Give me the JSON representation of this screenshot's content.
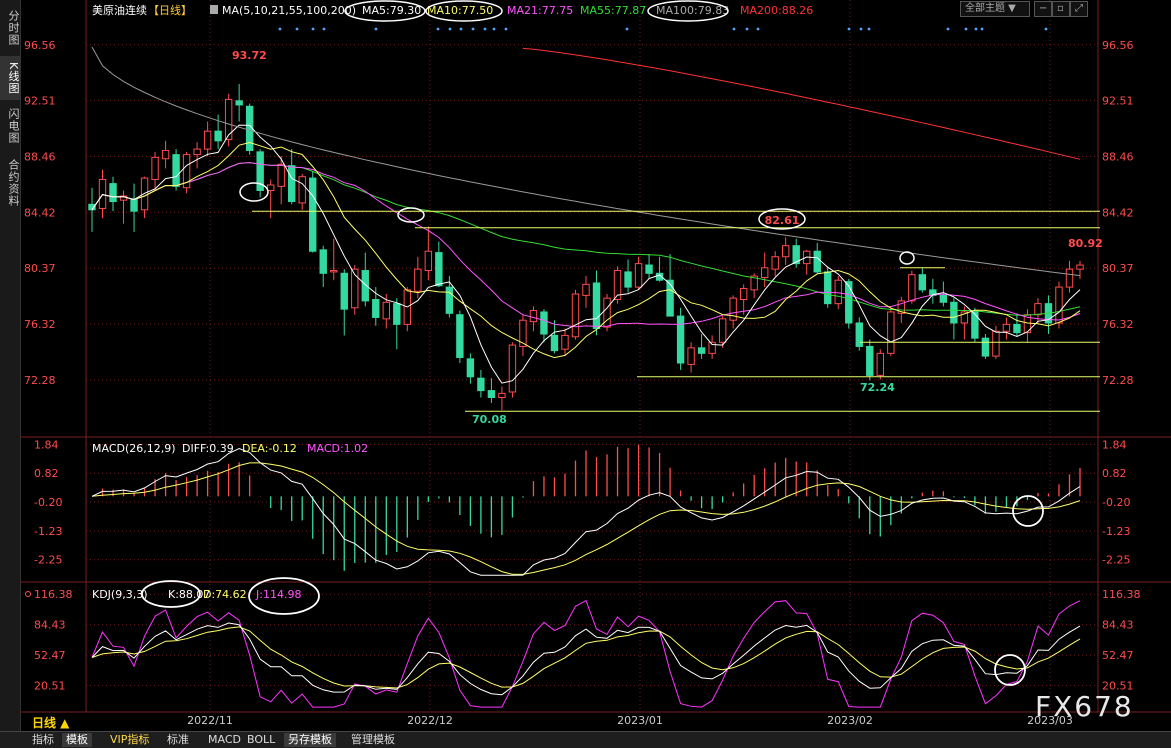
{
  "left_tabs": [
    {
      "label": "分时图",
      "active": false
    },
    {
      "label": "K线图",
      "active": true
    },
    {
      "label": "闪电图",
      "active": false
    },
    {
      "label": "合约资料",
      "active": false
    }
  ],
  "header": {
    "symbol": "美原油连续",
    "period": "【日线】",
    "ma_title": "MA(5,10,21,55,100,200)",
    "ma5": "MA5:79.30",
    "ma10": "MA10:77.50",
    "ma21": "MA21:77.75",
    "ma55": "MA55:77.87",
    "ma100": "MA100:79.83",
    "ma200": "MA200:88.26",
    "select": "全部主题"
  },
  "colors": {
    "up": "#ff4c4c",
    "down": "#33d9a0",
    "ma5": "#ffffff",
    "ma10": "#ffff66",
    "ma21": "#ff55ff",
    "ma55": "#33dd33",
    "ma100": "#999999",
    "ma200": "#ff3333",
    "price_axis": "#ff4c4c",
    "grid": "#6e1a1a"
  },
  "chart_data": [
    {
      "type": "candlestick",
      "title": "美原油连续【日线】",
      "yticks": [
        "96.56",
        "92.51",
        "88.46",
        "84.42",
        "80.37",
        "76.32",
        "72.28"
      ],
      "ylim": [
        68.5,
        98.5
      ],
      "xticks": [
        "2022/11",
        "2022/12",
        "2023/01",
        "2023/02",
        "2023/03"
      ],
      "annotations": [
        "93.72",
        "82.61",
        "80.92",
        "72.24",
        "70.08"
      ],
      "horizontal_levels": [
        84.5,
        83.3,
        80.4,
        75.0,
        72.5,
        70.0
      ],
      "ohlc": [
        [
          85.0,
          86.2,
          83.0,
          84.6
        ],
        [
          84.7,
          87.5,
          84.0,
          86.8
        ],
        [
          86.5,
          87.0,
          84.5,
          85.2
        ],
        [
          85.3,
          86.0,
          83.6,
          85.6
        ],
        [
          85.4,
          86.5,
          83.0,
          84.5
        ],
        [
          84.6,
          87.0,
          84.0,
          86.9
        ],
        [
          86.8,
          88.8,
          86.0,
          88.4
        ],
        [
          88.3,
          89.6,
          87.6,
          88.9
        ],
        [
          88.6,
          89.0,
          86.0,
          86.3
        ],
        [
          86.2,
          88.8,
          85.8,
          88.6
        ],
        [
          88.6,
          89.5,
          87.6,
          89.0
        ],
        [
          89.0,
          91.0,
          88.5,
          90.3
        ],
        [
          90.3,
          91.5,
          89.0,
          89.6
        ],
        [
          89.7,
          93.0,
          89.2,
          92.6
        ],
        [
          92.5,
          93.72,
          91.0,
          92.2
        ],
        [
          92.1,
          92.3,
          88.6,
          88.9
        ],
        [
          88.8,
          89.0,
          85.5,
          86.0
        ],
        [
          86.0,
          86.8,
          84.0,
          86.4
        ],
        [
          86.3,
          88.5,
          85.0,
          87.9
        ],
        [
          87.8,
          89.0,
          85.0,
          85.2
        ],
        [
          85.1,
          87.2,
          84.6,
          87.0
        ],
        [
          86.9,
          87.4,
          81.5,
          81.6
        ],
        [
          81.7,
          82.0,
          79.0,
          80.0
        ],
        [
          80.1,
          82.5,
          79.5,
          80.2
        ],
        [
          80.0,
          80.3,
          75.5,
          77.4
        ],
        [
          77.5,
          80.6,
          77.0,
          80.3
        ],
        [
          80.2,
          81.5,
          77.6,
          78.0
        ],
        [
          78.1,
          79.0,
          76.2,
          76.8
        ],
        [
          76.7,
          78.5,
          76.0,
          77.9
        ],
        [
          77.8,
          78.2,
          74.5,
          76.3
        ],
        [
          76.3,
          79.0,
          75.8,
          78.8
        ],
        [
          78.7,
          81.2,
          78.2,
          80.3
        ],
        [
          80.2,
          83.4,
          79.5,
          81.6
        ],
        [
          81.5,
          82.3,
          79.0,
          79.1
        ],
        [
          79.0,
          79.8,
          76.8,
          77.1
        ],
        [
          77.0,
          77.3,
          73.5,
          73.9
        ],
        [
          73.8,
          74.2,
          72.0,
          72.5
        ],
        [
          72.4,
          73.0,
          71.0,
          71.5
        ],
        [
          71.5,
          72.4,
          70.6,
          71.0
        ],
        [
          71.0,
          71.8,
          70.08,
          71.3
        ],
        [
          71.4,
          75.0,
          71.0,
          74.8
        ],
        [
          74.7,
          77.0,
          74.0,
          76.6
        ],
        [
          76.5,
          77.6,
          75.8,
          77.3
        ],
        [
          77.2,
          77.4,
          75.0,
          75.6
        ],
        [
          75.5,
          76.6,
          74.2,
          74.4
        ],
        [
          74.5,
          76.0,
          74.0,
          75.5
        ],
        [
          75.4,
          78.8,
          75.2,
          78.5
        ],
        [
          78.4,
          79.8,
          77.5,
          79.2
        ],
        [
          79.3,
          80.2,
          75.5,
          76.0
        ],
        [
          76.1,
          78.5,
          75.8,
          78.2
        ],
        [
          78.1,
          80.5,
          77.8,
          80.2
        ],
        [
          80.1,
          81.0,
          78.6,
          79.0
        ],
        [
          79.0,
          81.2,
          78.8,
          80.7
        ],
        [
          80.6,
          81.4,
          79.6,
          80.0
        ],
        [
          80.0,
          81.2,
          79.4,
          79.5
        ],
        [
          79.5,
          81.4,
          78.0,
          76.9
        ],
        [
          76.9,
          77.5,
          73.0,
          73.5
        ],
        [
          73.4,
          75.0,
          72.8,
          74.6
        ],
        [
          74.6,
          75.6,
          73.8,
          74.2
        ],
        [
          74.2,
          75.5,
          73.8,
          75.0
        ],
        [
          75.0,
          76.9,
          74.6,
          76.7
        ],
        [
          76.6,
          78.4,
          76.0,
          78.2
        ],
        [
          78.1,
          79.2,
          77.0,
          78.9
        ],
        [
          78.8,
          80.0,
          78.2,
          79.8
        ],
        [
          79.7,
          81.5,
          79.0,
          80.4
        ],
        [
          80.3,
          81.6,
          79.8,
          81.2
        ],
        [
          81.2,
          82.61,
          80.6,
          82.0
        ],
        [
          82.0,
          82.5,
          80.4,
          80.7
        ],
        [
          80.7,
          81.7,
          79.9,
          81.6
        ],
        [
          81.6,
          82.2,
          80.0,
          80.1
        ],
        [
          80.1,
          80.5,
          77.5,
          77.8
        ],
        [
          77.8,
          79.8,
          77.4,
          79.5
        ],
        [
          79.4,
          79.6,
          76.0,
          76.4
        ],
        [
          76.4,
          76.8,
          74.4,
          74.7
        ],
        [
          74.7,
          75.2,
          72.24,
          72.6
        ],
        [
          72.6,
          74.5,
          72.3,
          74.2
        ],
        [
          74.2,
          77.5,
          74.0,
          77.2
        ],
        [
          77.1,
          78.3,
          76.4,
          78.0
        ],
        [
          78.0,
          80.2,
          77.8,
          79.9
        ],
        [
          79.9,
          80.4,
          78.6,
          78.8
        ],
        [
          78.8,
          79.6,
          77.8,
          78.4
        ],
        [
          78.4,
          79.4,
          77.6,
          77.9
        ],
        [
          77.9,
          78.2,
          75.2,
          76.4
        ],
        [
          76.4,
          77.6,
          75.2,
          77.2
        ],
        [
          77.2,
          77.5,
          75.0,
          75.3
        ],
        [
          75.3,
          75.6,
          73.8,
          74.0
        ],
        [
          74.0,
          76.2,
          73.8,
          75.8
        ],
        [
          75.8,
          76.8,
          75.2,
          76.3
        ],
        [
          76.3,
          77.1,
          75.4,
          75.7
        ],
        [
          75.7,
          77.4,
          75.0,
          77.0
        ],
        [
          77.0,
          78.2,
          76.4,
          77.8
        ],
        [
          77.8,
          78.4,
          75.6,
          76.4
        ],
        [
          76.4,
          79.4,
          76.0,
          79.0
        ],
        [
          79.0,
          80.92,
          78.6,
          80.3
        ],
        [
          80.3,
          80.9,
          79.6,
          80.6
        ]
      ],
      "ma5_end": 79.3,
      "ma10_end": 77.5,
      "ma21_end": 77.75,
      "ma55_end": 77.87,
      "ma100_end": 79.83,
      "ma200_end": 88.26
    },
    {
      "type": "line",
      "title": "MACD(26,12,9)",
      "legend": [
        "DIFF:0.39",
        "DEA:-0.12",
        "MACD:1.02"
      ],
      "yticks": [
        "1.84",
        "0.82",
        "-0.20",
        "-1.23",
        "-2.25"
      ],
      "ylim": [
        -2.9,
        2.0
      ]
    },
    {
      "type": "line",
      "title": "KDJ(9,3,3)",
      "legend": [
        "K:88.07",
        "D:74.62",
        "J:114.98"
      ],
      "yticks": [
        "116.38",
        "84.43",
        "52.47",
        "20.51"
      ],
      "ylim": [
        -5,
        125
      ]
    }
  ],
  "bottom_tabs": [
    {
      "label": "指标",
      "sel": false,
      "vip": false
    },
    {
      "label": "模板",
      "sel": true,
      "vip": false
    },
    {
      "label": "VIP指标",
      "sel": false,
      "vip": true
    },
    {
      "label": "标准",
      "sel": false,
      "vip": false
    },
    {
      "label": "MACD",
      "sel": false,
      "vip": false
    },
    {
      "label": "BOLL",
      "sel": false,
      "vip": false
    },
    {
      "label": "另存模板",
      "sel": true,
      "vip": false
    },
    {
      "label": "管理模板",
      "sel": false,
      "vip": false
    }
  ],
  "period_label": "日线 ▲",
  "watermark": "FX678"
}
